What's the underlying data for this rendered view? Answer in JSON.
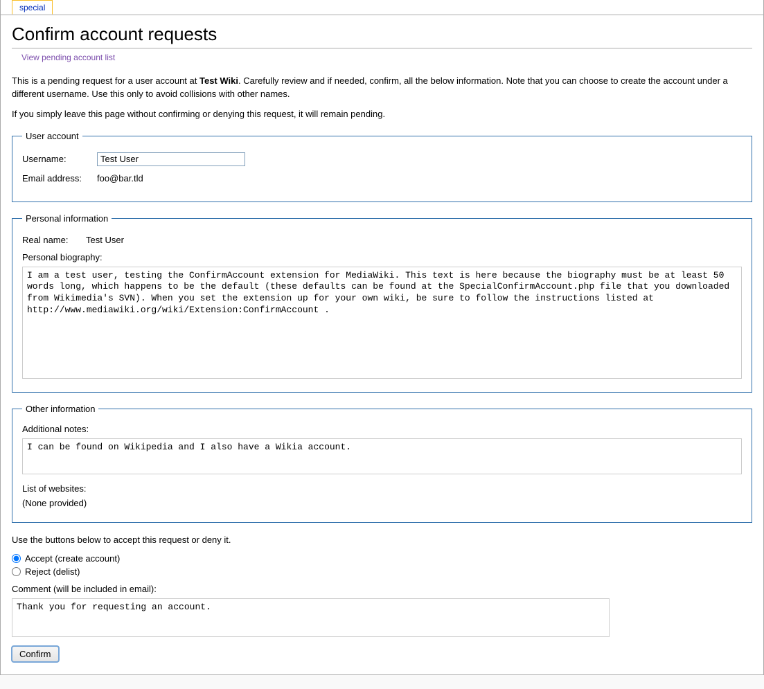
{
  "tab": {
    "label": "special"
  },
  "page": {
    "title": "Confirm account requests",
    "subtitle_link": "View pending account list",
    "intro_prefix": "This is a pending request for a user account at ",
    "intro_wiki": "Test Wiki",
    "intro_suffix": ". Carefully review and if needed, confirm, all the below information. Note that you can choose to create the account under a different username. Use this only to avoid collisions with other names.",
    "intro2": "If you simply leave this page without confirming or denying this request, it will remain pending."
  },
  "user_account": {
    "legend": "User account",
    "username_label": "Username:",
    "username_value": "Test User",
    "email_label": "Email address:",
    "email_value": "foo@bar.tld"
  },
  "personal_info": {
    "legend": "Personal information",
    "realname_label": "Real name:",
    "realname_value": "Test User",
    "bio_label": "Personal biography:",
    "bio_value": "I am a test user, testing the ConfirmAccount extension for MediaWiki. This text is here because the biography must be at least 50 words long, which happens to be the default (these defaults can be found at the SpecialConfirmAccount.php file that you downloaded from Wikimedia's SVN). When you set the extension up for your own wiki, be sure to follow the instructions listed at http://www.mediawiki.org/wiki/Extension:ConfirmAccount ."
  },
  "other_info": {
    "legend": "Other information",
    "notes_label": "Additional notes:",
    "notes_value": "I can be found on Wikipedia and I also have a Wikia account.",
    "websites_label": "List of websites:",
    "websites_value": "(None provided)"
  },
  "actions": {
    "instruction": "Use the buttons below to accept this request or deny it.",
    "accept_label": "Accept (create account)",
    "reject_label": "Reject (delist)",
    "comment_label": "Comment (will be included in email):",
    "comment_value": "Thank you for requesting an account.",
    "confirm_button": "Confirm"
  }
}
